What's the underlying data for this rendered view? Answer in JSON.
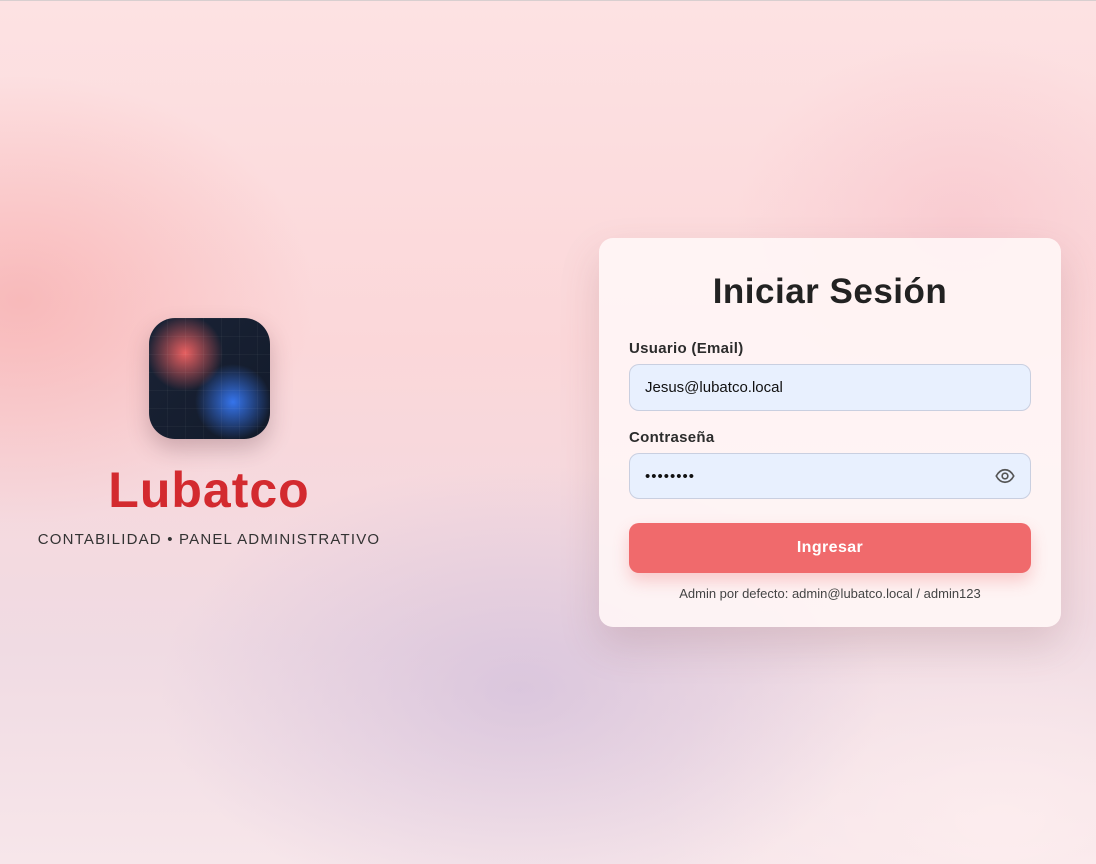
{
  "brand": {
    "name": "Lubatco",
    "subtitle": "CONTABILIDAD • PANEL ADMINISTRATIVO",
    "logo_icon": "lubatco-logo-icon"
  },
  "login": {
    "title": "Iniciar Sesión",
    "email_label": "Usuario (Email)",
    "email_value": "Jesus@lubatco.local",
    "password_label": "Contraseña",
    "password_value": "••••••••",
    "toggle_icon": "eye-icon",
    "submit_label": "Ingresar",
    "hint": "Admin por defecto: admin@lubatco.local / admin123"
  },
  "colors": {
    "brand_red": "#d32a2f",
    "button": "#f06a6c",
    "input_bg": "#e8f0fe"
  }
}
